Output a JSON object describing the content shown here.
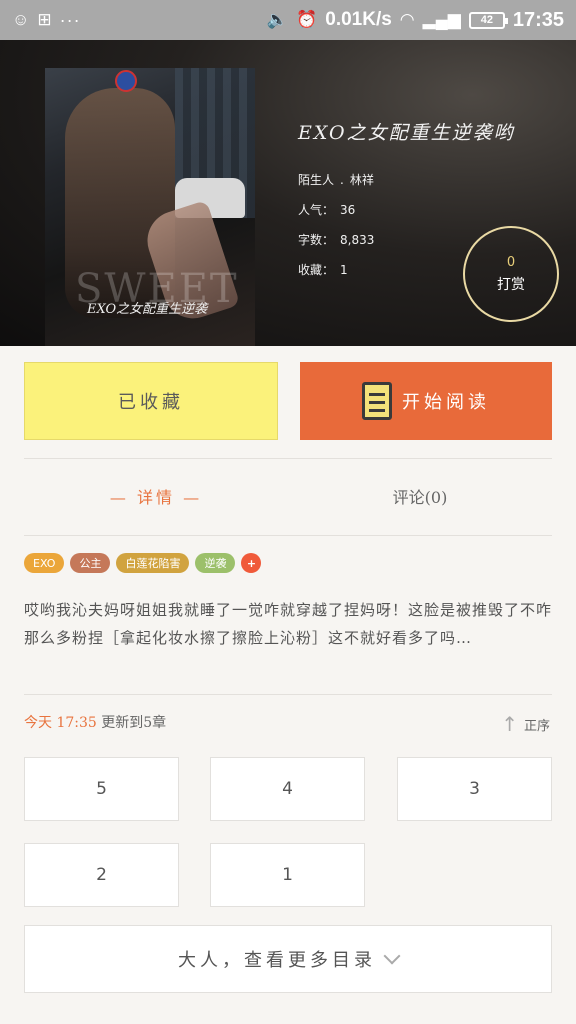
{
  "status_bar": {
    "speed": "0.01K/s",
    "battery": "42",
    "time": "17:35"
  },
  "book": {
    "title": "EXO之女配重生逆袭哟",
    "cover_watermark": "SWEET",
    "cover_caption": "EXO之女配重生逆袭",
    "author_label": "陌生人",
    "author": "林祥",
    "popularity_label": "人气：",
    "popularity": "36",
    "words_label": "字数：",
    "words": "8,833",
    "favorites_label": "收藏：",
    "favorites": "1"
  },
  "tip": {
    "count": "0",
    "label": "打赏"
  },
  "actions": {
    "favorited": "已收藏",
    "start_reading": "开始阅读"
  },
  "tabs": {
    "detail": "— 详情 —",
    "comments": "评论(0)"
  },
  "tags": [
    {
      "label": "EXO",
      "color": "#eba63a"
    },
    {
      "label": "公主",
      "color": "#c57859"
    },
    {
      "label": "白莲花陷害",
      "color": "#d1a33f"
    },
    {
      "label": "逆袭",
      "color": "#9cc06a"
    },
    {
      "label": "+",
      "color": "#f05a3a"
    }
  ],
  "description": "哎哟我沁夫妈呀姐姐我就睡了一觉咋就穿越了捏妈呀！这脸是被推毁了不咋那么多粉捏［拿起化妆水擦了擦脸上沁粉］这不就好看多了吗…",
  "update": {
    "today": "今天",
    "time": "17:35",
    "text": "更新到5章"
  },
  "sort_label": "正序",
  "chapters": [
    "5",
    "4",
    "3",
    "2",
    "1"
  ],
  "more_label": "大人，查看更多目录",
  "colors": {
    "accent": "#e8743f",
    "read_button": "#e86a3a",
    "fav_button": "#fbf27b"
  }
}
